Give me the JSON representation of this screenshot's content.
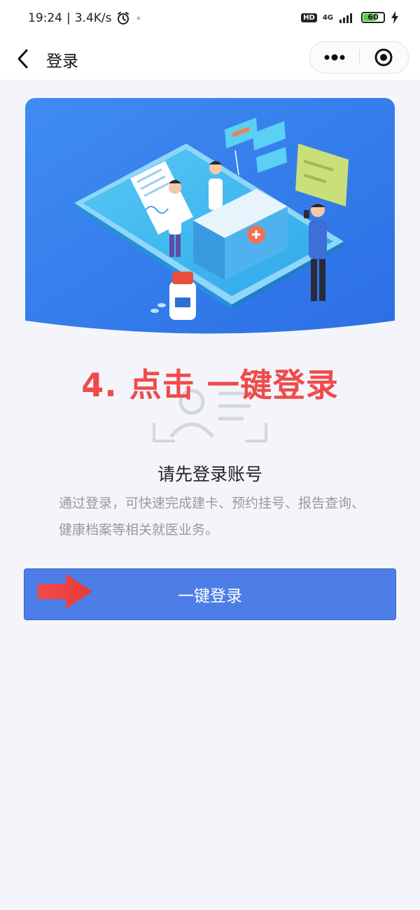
{
  "status_bar": {
    "time": "19:24",
    "network_speed": "3.4K/s",
    "hd_label": "HD",
    "network_type": "4G",
    "battery_level": "60"
  },
  "nav": {
    "title": "登录"
  },
  "instruction_overlay": "4. 点击 一键登录",
  "login": {
    "heading": "请先登录账号",
    "description": "通过登录，可快速完成建卡、预约挂号、报告查询、健康档案等相关就医业务。",
    "button_label": "一键登录"
  },
  "colors": {
    "accent": "#4d7de6",
    "instruction": "#ef4b4b",
    "background": "#f4f5fa"
  }
}
